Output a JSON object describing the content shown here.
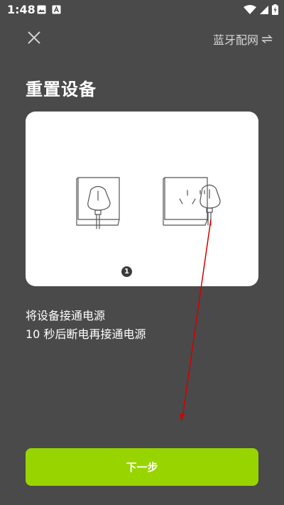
{
  "status_bar": {
    "time": "1:48",
    "left_icons": [
      "image-icon",
      "app-icon"
    ],
    "right_icons": [
      "wifi-icon",
      "signal-icon",
      "battery-icon"
    ]
  },
  "header": {
    "close_icon": "close-icon",
    "bt_link_label": "蓝牙配网",
    "bt_link_icon": "swap-icon"
  },
  "page": {
    "title": "重置设备"
  },
  "illustration": {
    "step_number": "1"
  },
  "instructions": [
    "将设备接通电源",
    "10 秒后断电再接通电源"
  ],
  "footer": {
    "next_label": "下一步"
  },
  "colors": {
    "background": "#4a4a4a",
    "accent": "#98d400",
    "annotation": "#d40000"
  }
}
